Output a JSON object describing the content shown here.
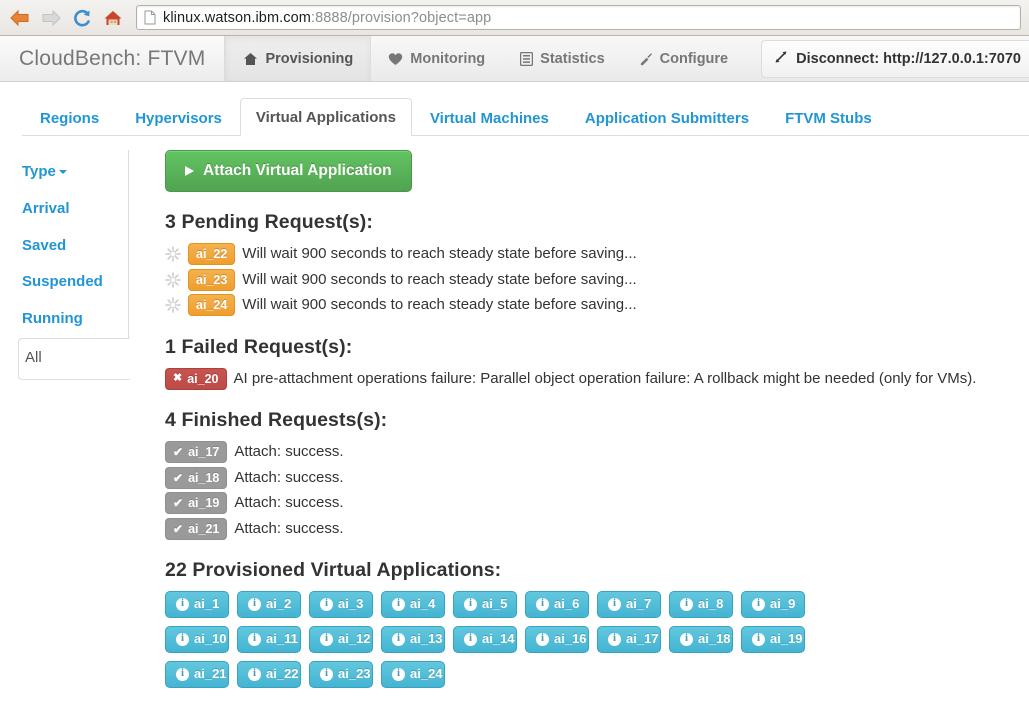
{
  "browser": {
    "back_icon": "back-arrow-icon",
    "forward_icon": "forward-arrow-icon",
    "reload_icon": "reload-icon",
    "home_icon": "home-icon",
    "page_icon": "page-icon",
    "url_host": "klinux.watson.ibm.com",
    "url_rest": ":8888/provision?object=app"
  },
  "navbar": {
    "brand": "CloudBench: FTVM",
    "items": [
      {
        "label": "Provisioning",
        "icon": "home-icon",
        "active": true
      },
      {
        "label": "Monitoring",
        "icon": "heart-icon",
        "active": false
      },
      {
        "label": "Statistics",
        "icon": "list-icon",
        "active": false
      },
      {
        "label": "Configure",
        "icon": "wrench-icon",
        "active": false
      }
    ],
    "right_item": {
      "label": "Disconnect: http://127.0.0.1:7070",
      "icon": "resize-arrow-icon"
    }
  },
  "tabs": [
    {
      "label": "Regions",
      "active": false
    },
    {
      "label": "Hypervisors",
      "active": false
    },
    {
      "label": "Virtual Applications",
      "active": true
    },
    {
      "label": "Virtual Machines",
      "active": false
    },
    {
      "label": "Application Submitters",
      "active": false
    },
    {
      "label": "FTVM Stubs",
      "active": false
    }
  ],
  "sidebar": {
    "items": [
      {
        "label": "Type",
        "caret": true,
        "active": false
      },
      {
        "label": "Arrival",
        "caret": false,
        "active": false
      },
      {
        "label": "Saved",
        "caret": false,
        "active": false
      },
      {
        "label": "Suspended",
        "caret": false,
        "active": false
      },
      {
        "label": "Running",
        "caret": false,
        "active": false
      },
      {
        "label": "All",
        "caret": false,
        "active": true
      }
    ]
  },
  "main": {
    "attach_button": "Attach Virtual Application",
    "pending": {
      "title": "3 Pending Request(s):",
      "rows": [
        {
          "id": "ai_22",
          "text": "Will wait 900 seconds to reach steady state before saving...",
          "icon": "spinner-icon"
        },
        {
          "id": "ai_23",
          "text": "Will wait 900 seconds to reach steady state before saving...",
          "icon": "spinner-icon"
        },
        {
          "id": "ai_24",
          "text": "Will wait 900 seconds to reach steady state before saving...",
          "icon": "spinner-icon"
        }
      ]
    },
    "failed": {
      "title": "1 Failed Request(s):",
      "rows": [
        {
          "id": "ai_20",
          "text": "AI pre-attachment operations failure: Parallel object operation failure: A rollback might be needed (only for VMs).",
          "icon": "close-x-icon"
        }
      ]
    },
    "finished": {
      "title": "4 Finished Requests(s):",
      "rows": [
        {
          "id": "ai_17",
          "text": "Attach: success.",
          "icon": "check-icon"
        },
        {
          "id": "ai_18",
          "text": "Attach: success.",
          "icon": "check-icon"
        },
        {
          "id": "ai_19",
          "text": "Attach: success.",
          "icon": "check-icon"
        },
        {
          "id": "ai_21",
          "text": "Attach: success.",
          "icon": "check-icon"
        }
      ]
    },
    "provisioned": {
      "title": "22 Provisioned Virtual Applications:",
      "items": [
        "ai_1",
        "ai_2",
        "ai_3",
        "ai_4",
        "ai_5",
        "ai_6",
        "ai_7",
        "ai_8",
        "ai_9",
        "ai_10",
        "ai_11",
        "ai_12",
        "ai_13",
        "ai_14",
        "ai_16",
        "ai_17",
        "ai_18",
        "ai_19",
        "ai_21",
        "ai_22",
        "ai_23",
        "ai_24"
      ]
    }
  },
  "colors": {
    "link_blue": "#2196d4",
    "success_green": "#51a351",
    "warning_orange": "#ef9e2f",
    "danger_red": "#bd4b47",
    "info_teal": "#45b4d2",
    "muted_gray": "#9a9a9a"
  }
}
